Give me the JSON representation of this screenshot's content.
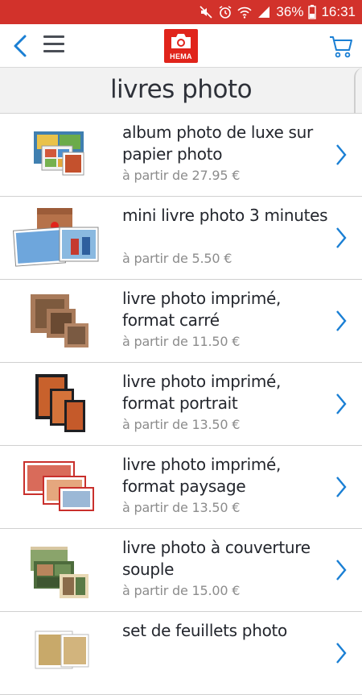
{
  "status_bar": {
    "battery": "36%",
    "time": "16:31",
    "icons": [
      "mute-icon",
      "alarm-icon",
      "wifi-icon",
      "signal-icon",
      "battery-icon"
    ]
  },
  "app_bar": {
    "logo_text": "HEMA",
    "icons": [
      "back-arrow-icon",
      "hamburger-menu-icon",
      "camera-logo-icon",
      "shopping-cart-icon"
    ]
  },
  "page": {
    "title": "livres photo"
  },
  "colors": {
    "status_bar": "#d2322b",
    "brand_red": "#e0241b",
    "accent_blue": "#1a7fd4",
    "title_bar": "#f2f2f2",
    "price_gray": "#8c8c8c"
  },
  "products": [
    {
      "name": "album photo de luxe sur papier photo",
      "price": "à partir de 27.95 €"
    },
    {
      "name": "mini livre photo 3 minutes",
      "price": "à partir de 5.50 €"
    },
    {
      "name": "livre photo imprimé, format carré",
      "price": "à partir de 11.50 €"
    },
    {
      "name": "livre photo imprimé, format portrait",
      "price": "à partir de 13.50 €"
    },
    {
      "name": "livre photo imprimé, format paysage",
      "price": "à partir de 13.50 €"
    },
    {
      "name": "livre photo à couverture souple",
      "price": "à partir de 15.00 €"
    },
    {
      "name": "set de feuillets photo",
      "price": ""
    }
  ]
}
